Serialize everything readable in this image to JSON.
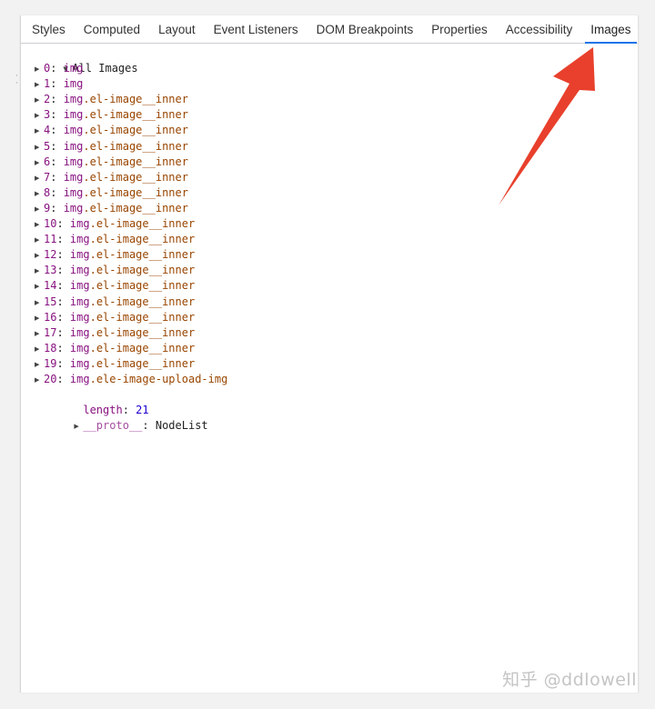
{
  "tabs": [
    {
      "label": "Styles",
      "active": false
    },
    {
      "label": "Computed",
      "active": false
    },
    {
      "label": "Layout",
      "active": false
    },
    {
      "label": "Event Listeners",
      "active": false
    },
    {
      "label": "DOM Breakpoints",
      "active": false
    },
    {
      "label": "Properties",
      "active": false
    },
    {
      "label": "Accessibility",
      "active": false
    },
    {
      "label": "Images",
      "active": true
    }
  ],
  "tree": {
    "root_label": "All Images",
    "items": [
      {
        "index": "0",
        "tag": "img",
        "cls": ""
      },
      {
        "index": "1",
        "tag": "img",
        "cls": ""
      },
      {
        "index": "2",
        "tag": "img",
        "cls": ".el-image__inner"
      },
      {
        "index": "3",
        "tag": "img",
        "cls": ".el-image__inner"
      },
      {
        "index": "4",
        "tag": "img",
        "cls": ".el-image__inner"
      },
      {
        "index": "5",
        "tag": "img",
        "cls": ".el-image__inner"
      },
      {
        "index": "6",
        "tag": "img",
        "cls": ".el-image__inner"
      },
      {
        "index": "7",
        "tag": "img",
        "cls": ".el-image__inner"
      },
      {
        "index": "8",
        "tag": "img",
        "cls": ".el-image__inner"
      },
      {
        "index": "9",
        "tag": "img",
        "cls": ".el-image__inner"
      },
      {
        "index": "10",
        "tag": "img",
        "cls": ".el-image__inner"
      },
      {
        "index": "11",
        "tag": "img",
        "cls": ".el-image__inner"
      },
      {
        "index": "12",
        "tag": "img",
        "cls": ".el-image__inner"
      },
      {
        "index": "13",
        "tag": "img",
        "cls": ".el-image__inner"
      },
      {
        "index": "14",
        "tag": "img",
        "cls": ".el-image__inner"
      },
      {
        "index": "15",
        "tag": "img",
        "cls": ".el-image__inner"
      },
      {
        "index": "16",
        "tag": "img",
        "cls": ".el-image__inner"
      },
      {
        "index": "17",
        "tag": "img",
        "cls": ".el-image__inner"
      },
      {
        "index": "18",
        "tag": "img",
        "cls": ".el-image__inner"
      },
      {
        "index": "19",
        "tag": "img",
        "cls": ".el-image__inner"
      },
      {
        "index": "20",
        "tag": "img",
        "cls": ".ele-image-upload-img"
      }
    ],
    "length_key": "length",
    "length_value": "21",
    "proto_key": "__proto__",
    "proto_value": "NodeList"
  },
  "watermark": "知乎 @ddlowell",
  "colors": {
    "active_tab_underline": "#1a73e8",
    "arrow": "#e8402c",
    "index_purple": "#881280",
    "class_brown": "#994500",
    "number_blue": "#1c00cf"
  },
  "icons": {
    "expand": "triangle-right-icon",
    "collapse": "triangle-down-icon",
    "annotation": "red-arrow-icon"
  }
}
